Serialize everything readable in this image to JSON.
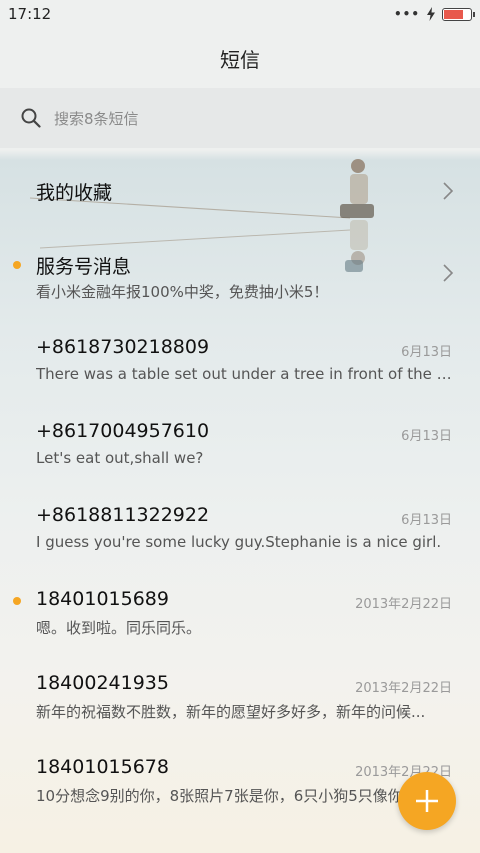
{
  "status_bar": {
    "time": "17:12",
    "battery_level_percent": 75,
    "icons": [
      "more-dots-icon",
      "charging-icon",
      "battery-icon"
    ]
  },
  "header": {
    "title": "短信"
  },
  "search": {
    "placeholder": "搜索8条短信"
  },
  "conversations": [
    {
      "title": "我的收藏",
      "preview": "",
      "date": "",
      "unread": false,
      "chevron": true
    },
    {
      "title": "服务号消息",
      "preview": "看小米金融年报100%中奖，免费抽小米5！",
      "date": "",
      "unread": true,
      "chevron": true
    },
    {
      "title": "+8618730218809",
      "preview": "There was a table set out under a tree in front of the ho...",
      "date": "6月13日",
      "unread": false
    },
    {
      "title": "+8617004957610",
      "preview": "Let's eat out,shall we?",
      "date": "6月13日",
      "unread": false
    },
    {
      "title": "+8618811322922",
      "preview": "I guess you're some lucky guy.Stephanie is a nice girl.",
      "date": "6月13日",
      "unread": false
    },
    {
      "title": "18401015689",
      "preview": "嗯。收到啦。同乐同乐。",
      "date": "2013年2月22日",
      "unread": true
    },
    {
      "title": "18400241935",
      "preview": "新年的祝福数不胜数，新年的愿望好多好多，新年的问候...",
      "date": "2013年2月22日",
      "unread": false
    },
    {
      "title": "18401015678",
      "preview": "10分想念9别的你，8张照片7张是你，6只小狗5只像你",
      "date": "2013年2月22日",
      "unread": false
    }
  ],
  "colors": {
    "accent": "#f5a623",
    "search_bg": "#e6e8e8"
  }
}
